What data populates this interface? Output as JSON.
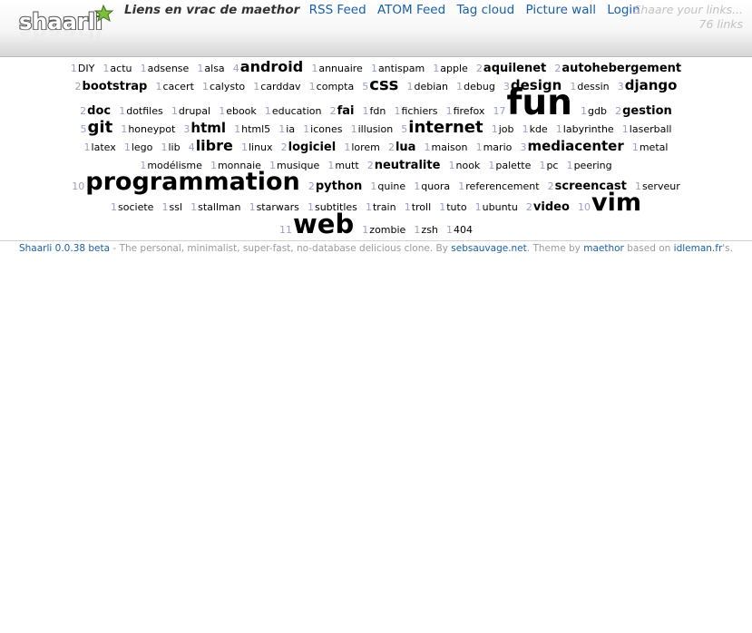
{
  "header": {
    "logo_text": "shaarli",
    "site_title": "Liens en vrac de maethor",
    "nav": [
      {
        "id": "rss",
        "label": "RSS Feed"
      },
      {
        "id": "atom",
        "label": "ATOM Feed"
      },
      {
        "id": "tagcloud",
        "label": "Tag cloud"
      },
      {
        "id": "picwall",
        "label": "Picture wall"
      },
      {
        "id": "login",
        "label": "Login"
      }
    ],
    "search_placeholder": "Shaare your links...",
    "link_count": "76 links"
  },
  "tags": [
    {
      "name": "DIY",
      "count": 1
    },
    {
      "name": "actu",
      "count": 1
    },
    {
      "name": "adsense",
      "count": 1
    },
    {
      "name": "alsa",
      "count": 1
    },
    {
      "name": "android",
      "count": 4
    },
    {
      "name": "annuaire",
      "count": 1
    },
    {
      "name": "antispam",
      "count": 1
    },
    {
      "name": "apple",
      "count": 1
    },
    {
      "name": "aquilenet",
      "count": 2
    },
    {
      "name": "autohebergement",
      "count": 2
    },
    {
      "name": "bootstrap",
      "count": 2
    },
    {
      "name": "cacert",
      "count": 1
    },
    {
      "name": "calysto",
      "count": 1
    },
    {
      "name": "carddav",
      "count": 1
    },
    {
      "name": "compta",
      "count": 1
    },
    {
      "name": "css",
      "count": 5
    },
    {
      "name": "debian",
      "count": 1
    },
    {
      "name": "debug",
      "count": 1
    },
    {
      "name": "design",
      "count": 3
    },
    {
      "name": "dessin",
      "count": 1
    },
    {
      "name": "django",
      "count": 3
    },
    {
      "name": "doc",
      "count": 2
    },
    {
      "name": "dotfiles",
      "count": 1
    },
    {
      "name": "drupal",
      "count": 1
    },
    {
      "name": "ebook",
      "count": 1
    },
    {
      "name": "education",
      "count": 1
    },
    {
      "name": "fai",
      "count": 2
    },
    {
      "name": "fdn",
      "count": 1
    },
    {
      "name": "fichiers",
      "count": 1
    },
    {
      "name": "firefox",
      "count": 1
    },
    {
      "name": "fun",
      "count": 17
    },
    {
      "name": "gdb",
      "count": 1
    },
    {
      "name": "gestion",
      "count": 2
    },
    {
      "name": "git",
      "count": 5
    },
    {
      "name": "honeypot",
      "count": 1
    },
    {
      "name": "html",
      "count": 3
    },
    {
      "name": "html5",
      "count": 1
    },
    {
      "name": "ia",
      "count": 1
    },
    {
      "name": "icones",
      "count": 1
    },
    {
      "name": "illusion",
      "count": 1
    },
    {
      "name": "internet",
      "count": 5
    },
    {
      "name": "job",
      "count": 1
    },
    {
      "name": "kde",
      "count": 1
    },
    {
      "name": "labyrinthe",
      "count": 1
    },
    {
      "name": "laserball",
      "count": 1
    },
    {
      "name": "latex",
      "count": 1
    },
    {
      "name": "lego",
      "count": 1
    },
    {
      "name": "lib",
      "count": 1
    },
    {
      "name": "libre",
      "count": 4
    },
    {
      "name": "linux",
      "count": 1
    },
    {
      "name": "logiciel",
      "count": 2
    },
    {
      "name": "lorem",
      "count": 1
    },
    {
      "name": "lua",
      "count": 2
    },
    {
      "name": "maison",
      "count": 1
    },
    {
      "name": "mario",
      "count": 1
    },
    {
      "name": "mediacenter",
      "count": 3
    },
    {
      "name": "metal",
      "count": 1
    },
    {
      "name": "modélisme",
      "count": 1
    },
    {
      "name": "monnaie",
      "count": 1
    },
    {
      "name": "musique",
      "count": 1
    },
    {
      "name": "mutt",
      "count": 1
    },
    {
      "name": "neutralite",
      "count": 2
    },
    {
      "name": "nook",
      "count": 1
    },
    {
      "name": "palette",
      "count": 1
    },
    {
      "name": "pc",
      "count": 1
    },
    {
      "name": "peering",
      "count": 1
    },
    {
      "name": "programmation",
      "count": 10
    },
    {
      "name": "python",
      "count": 2
    },
    {
      "name": "quine",
      "count": 1
    },
    {
      "name": "quora",
      "count": 1
    },
    {
      "name": "referencement",
      "count": 1
    },
    {
      "name": "screencast",
      "count": 2
    },
    {
      "name": "serveur",
      "count": 1
    },
    {
      "name": "societe",
      "count": 1
    },
    {
      "name": "ssl",
      "count": 1
    },
    {
      "name": "stallman",
      "count": 1
    },
    {
      "name": "starwars",
      "count": 1
    },
    {
      "name": "subtitles",
      "count": 1
    },
    {
      "name": "train",
      "count": 1
    },
    {
      "name": "troll",
      "count": 1
    },
    {
      "name": "tuto",
      "count": 1
    },
    {
      "name": "ubuntu",
      "count": 1
    },
    {
      "name": "video",
      "count": 2
    },
    {
      "name": "vim",
      "count": 10
    },
    {
      "name": "web",
      "count": 11
    },
    {
      "name": "zombie",
      "count": 1
    },
    {
      "name": "zsh",
      "count": 1
    },
    {
      "name": "404",
      "count": 1
    }
  ],
  "footer": {
    "app_link": "Shaarli 0.0.38 beta",
    "text_1": " - The personal, minimalist, super-fast, no-database delicious clone. By ",
    "author_link": "sebsauvage.net",
    "text_2": ". Theme by ",
    "theme_author": "maethor",
    "text_3": " based on ",
    "base_link": "idleman.fr",
    "text_4": "'s."
  },
  "colors": {
    "link": "#1a5fa8",
    "tag_count": "#9a9fc6",
    "placeholder": "#c2c2c2",
    "logo_star": "#7cbf3b"
  }
}
